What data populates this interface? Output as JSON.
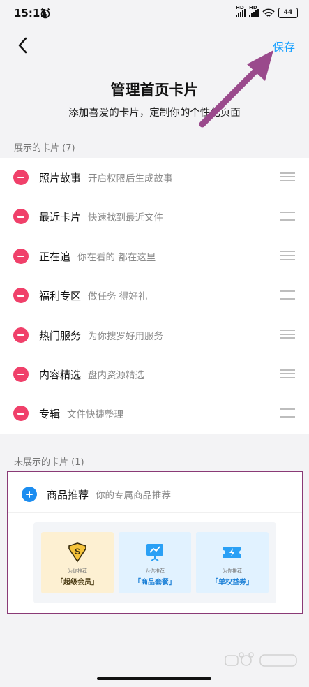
{
  "status": {
    "time": "15:11",
    "battery": "44",
    "signal_label": "HD"
  },
  "header": {
    "save_label": "保存"
  },
  "page": {
    "title": "管理首页卡片",
    "subtitle": "添加喜爱的卡片，定制你的个性化页面"
  },
  "shown": {
    "title": "展示的卡片 (7)",
    "items": [
      {
        "name": "照片故事",
        "desc": "开启权限后生成故事"
      },
      {
        "name": "最近卡片",
        "desc": "快速找到最近文件"
      },
      {
        "name": "正在追",
        "desc": "你在看的 都在这里"
      },
      {
        "name": "福利专区",
        "desc": "做任务 得好礼"
      },
      {
        "name": "热门服务",
        "desc": "为你搜罗好用服务"
      },
      {
        "name": "内容精选",
        "desc": "盘内资源精选"
      },
      {
        "name": "专辑",
        "desc": "文件快捷整理"
      }
    ]
  },
  "hidden": {
    "title": "未展示的卡片 (1)",
    "item": {
      "name": "商品推荐",
      "desc": "你的专属商品推荐"
    },
    "preview": [
      {
        "sub": "为你推荐",
        "label": "「超级会员」",
        "bg": "#fdf0d2",
        "color": "#4a3a12"
      },
      {
        "sub": "为你推荐",
        "label": "「商品套餐」",
        "bg": "#e1f2ff",
        "color": "#1a7fd6"
      },
      {
        "sub": "为你推荐",
        "label": "「单权益券」",
        "bg": "#e1f2ff",
        "color": "#1a7fd6"
      }
    ]
  },
  "colors": {
    "accent": "#1aa1ff",
    "remove": "#f0406a",
    "add": "#1c8df0",
    "highlight": "#8a3a76"
  }
}
